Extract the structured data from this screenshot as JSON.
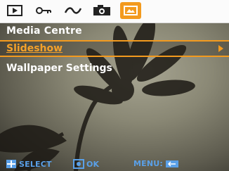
{
  "tabs": [
    {
      "icon": "playback-icon",
      "active": false
    },
    {
      "icon": "key-settings-icon",
      "active": false
    },
    {
      "icon": "tools-wave-icon",
      "active": false
    },
    {
      "icon": "camera-settings-icon",
      "active": false
    },
    {
      "icon": "media-centre-icon",
      "active": true
    }
  ],
  "menu": {
    "title": "Media Centre",
    "items": [
      {
        "label": "Slideshow",
        "selected": true
      },
      {
        "label": "Wallpaper Settings",
        "selected": false
      }
    ]
  },
  "footer": {
    "select_label": "SELECT",
    "ok_label": "OK",
    "menu_label": "MENU:"
  },
  "colors": {
    "accent": "#f39a1e",
    "hint_blue": "#5aa0e8"
  }
}
